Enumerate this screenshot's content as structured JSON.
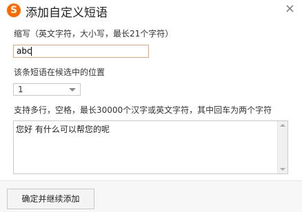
{
  "window": {
    "title": "添加自定义短语",
    "logo_glyph": "S",
    "close_glyph": "×"
  },
  "abbr": {
    "label": "缩写（英文字符，大小写，最长21个字符）",
    "value": "abc"
  },
  "position": {
    "label": "该条短语在候选中的位置",
    "selected": "1"
  },
  "phrase": {
    "label": "支持多行，空格，最长30000个汉字或英文字符，其中回车为两个字符",
    "value": "您好 有什么可以帮您的呢"
  },
  "footer": {
    "confirm_add_label": "确定并继续添加"
  },
  "colors": {
    "logo": "#ff6a00",
    "focus_border": "#f2a37a"
  }
}
